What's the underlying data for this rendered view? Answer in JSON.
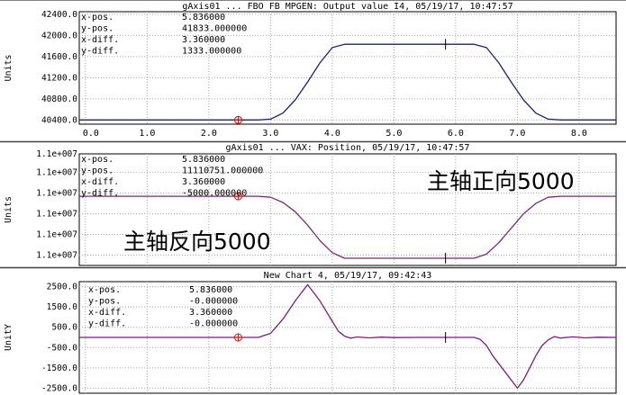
{
  "annotations": {
    "top_right": "主轴正向5000",
    "mid_left": "主轴反向5000"
  },
  "chart_data": [
    {
      "type": "line",
      "title": "gAxis01 ... FBO FB MPGEN: Output value I4, 05/19/17, 10:47:57",
      "ylabel": "Units",
      "xlim": [
        -0.1,
        8.6
      ],
      "ylim": [
        40320,
        42450
      ],
      "x_ticks": [
        0,
        1,
        2,
        3,
        4,
        5,
        6,
        7,
        8
      ],
      "x_tick_labels": [
        "0.0",
        "1.0",
        "2.0",
        "3.0",
        "4.0",
        "5.0",
        "6.0",
        "7.0",
        "8.0"
      ],
      "y_ticks": [
        40400,
        40800,
        41200,
        41600,
        42000,
        42400
      ],
      "y_tick_labels": [
        "40400.0",
        "40800.0",
        "41200.0",
        "41600.0",
        "42000.0",
        "42400.0"
      ],
      "color": "#1f1f7a",
      "series": [
        {
          "x": [
            -0.1,
            2.8,
            3.0,
            3.2,
            3.4,
            3.6,
            3.8,
            4.0,
            4.2,
            5.8,
            6.3,
            6.5,
            6.7,
            6.9,
            7.1,
            7.3,
            7.5,
            7.7,
            8.6
          ],
          "values": [
            40400,
            40400,
            40415,
            40530,
            40780,
            41120,
            41480,
            41770,
            41833,
            41833,
            41833,
            41770,
            41480,
            41120,
            40780,
            40530,
            40415,
            40400,
            40400
          ]
        }
      ],
      "cursor_x": 2.476,
      "cursor2_x": 5.836,
      "readout": [
        {
          "label": "x-pos.",
          "value": "5.836000"
        },
        {
          "label": "y-pos.",
          "value": "41833.000000"
        },
        {
          "label": "x-diff.",
          "value": "3.360000"
        },
        {
          "label": "y-diff.",
          "value": "1333.000000"
        }
      ]
    },
    {
      "type": "line",
      "title": "gAxis01 ... VAX: Position, 05/19/17, 10:47:57",
      "ylabel": "Units",
      "xlim": [
        -0.1,
        8.6
      ],
      "ylim": [
        0,
        5.4
      ],
      "y_ticks": [
        0.5,
        1.5,
        2.5,
        3.5,
        4.5,
        5.5
      ],
      "y_tick_labels": [
        "1.1e+007",
        "1.1e+007",
        "1.1e+007",
        "1.1e+007",
        "1.1e+007",
        "1.1e+007"
      ],
      "color": "#7a2a7a",
      "series": [
        {
          "x": [
            -0.1,
            2.8,
            3.0,
            3.2,
            3.4,
            3.6,
            3.8,
            4.0,
            4.2,
            5.8,
            6.3,
            6.5,
            6.7,
            6.9,
            7.1,
            7.3,
            7.5,
            7.7,
            8.6
          ],
          "values": [
            3.35,
            3.35,
            3.3,
            3.05,
            2.6,
            1.95,
            1.2,
            0.62,
            0.35,
            0.35,
            0.35,
            0.55,
            1.1,
            1.8,
            2.5,
            3.0,
            3.3,
            3.35,
            3.35
          ]
        }
      ],
      "cursor_x": 2.476,
      "cursor2_x": 5.836,
      "readout": [
        {
          "label": "x-pos.",
          "value": "5.836000"
        },
        {
          "label": "y-pos.",
          "value": "11110751.000000"
        },
        {
          "label": "x-diff.",
          "value": "3.360000"
        },
        {
          "label": "y-diff.",
          "value": "-5000.000000"
        }
      ]
    },
    {
      "type": "line",
      "title": "New Chart 4, 05/19/17, 09:42:43",
      "ylabel": "UnitY",
      "xlim": [
        -0.1,
        8.6
      ],
      "ylim": [
        -2750,
        2750
      ],
      "y_ticks": [
        -2500,
        -1500,
        -500,
        500,
        1500,
        2500
      ],
      "y_tick_labels": [
        "-2500.0",
        "-1500.0",
        "-500.0",
        "500.0",
        "1500.0",
        "2500.0"
      ],
      "color": "#7a1f7a",
      "series": [
        {
          "x": [
            -0.1,
            2.8,
            3.0,
            3.2,
            3.4,
            3.6,
            3.8,
            3.9,
            4.0,
            4.1,
            4.2,
            4.3,
            4.4,
            4.6,
            4.8,
            5.0,
            5.4,
            5.8,
            6.3,
            6.4,
            6.5,
            6.6,
            6.8,
            7.0,
            7.1,
            7.2,
            7.3,
            7.4,
            7.5,
            7.6,
            7.7,
            7.9,
            8.1,
            8.3,
            8.6
          ],
          "values": [
            0,
            0,
            200,
            900,
            1800,
            2600,
            1800,
            1300,
            800,
            300,
            60,
            -40,
            20,
            -20,
            15,
            -10,
            0,
            0,
            0,
            -100,
            -400,
            -900,
            -1700,
            -2500,
            -2100,
            -1500,
            -900,
            -400,
            -120,
            40,
            -30,
            25,
            -20,
            10,
            0
          ]
        }
      ],
      "cursor_x": 2.476,
      "cursor2_x": 5.836,
      "readout": [
        {
          "label": "x-pos.",
          "value": "5.836000"
        },
        {
          "label": "y-pos.",
          "value": "-0.000000"
        },
        {
          "label": "x-diff.",
          "value": "3.360000"
        },
        {
          "label": "y-diff.",
          "value": "-0.000000"
        }
      ]
    }
  ]
}
